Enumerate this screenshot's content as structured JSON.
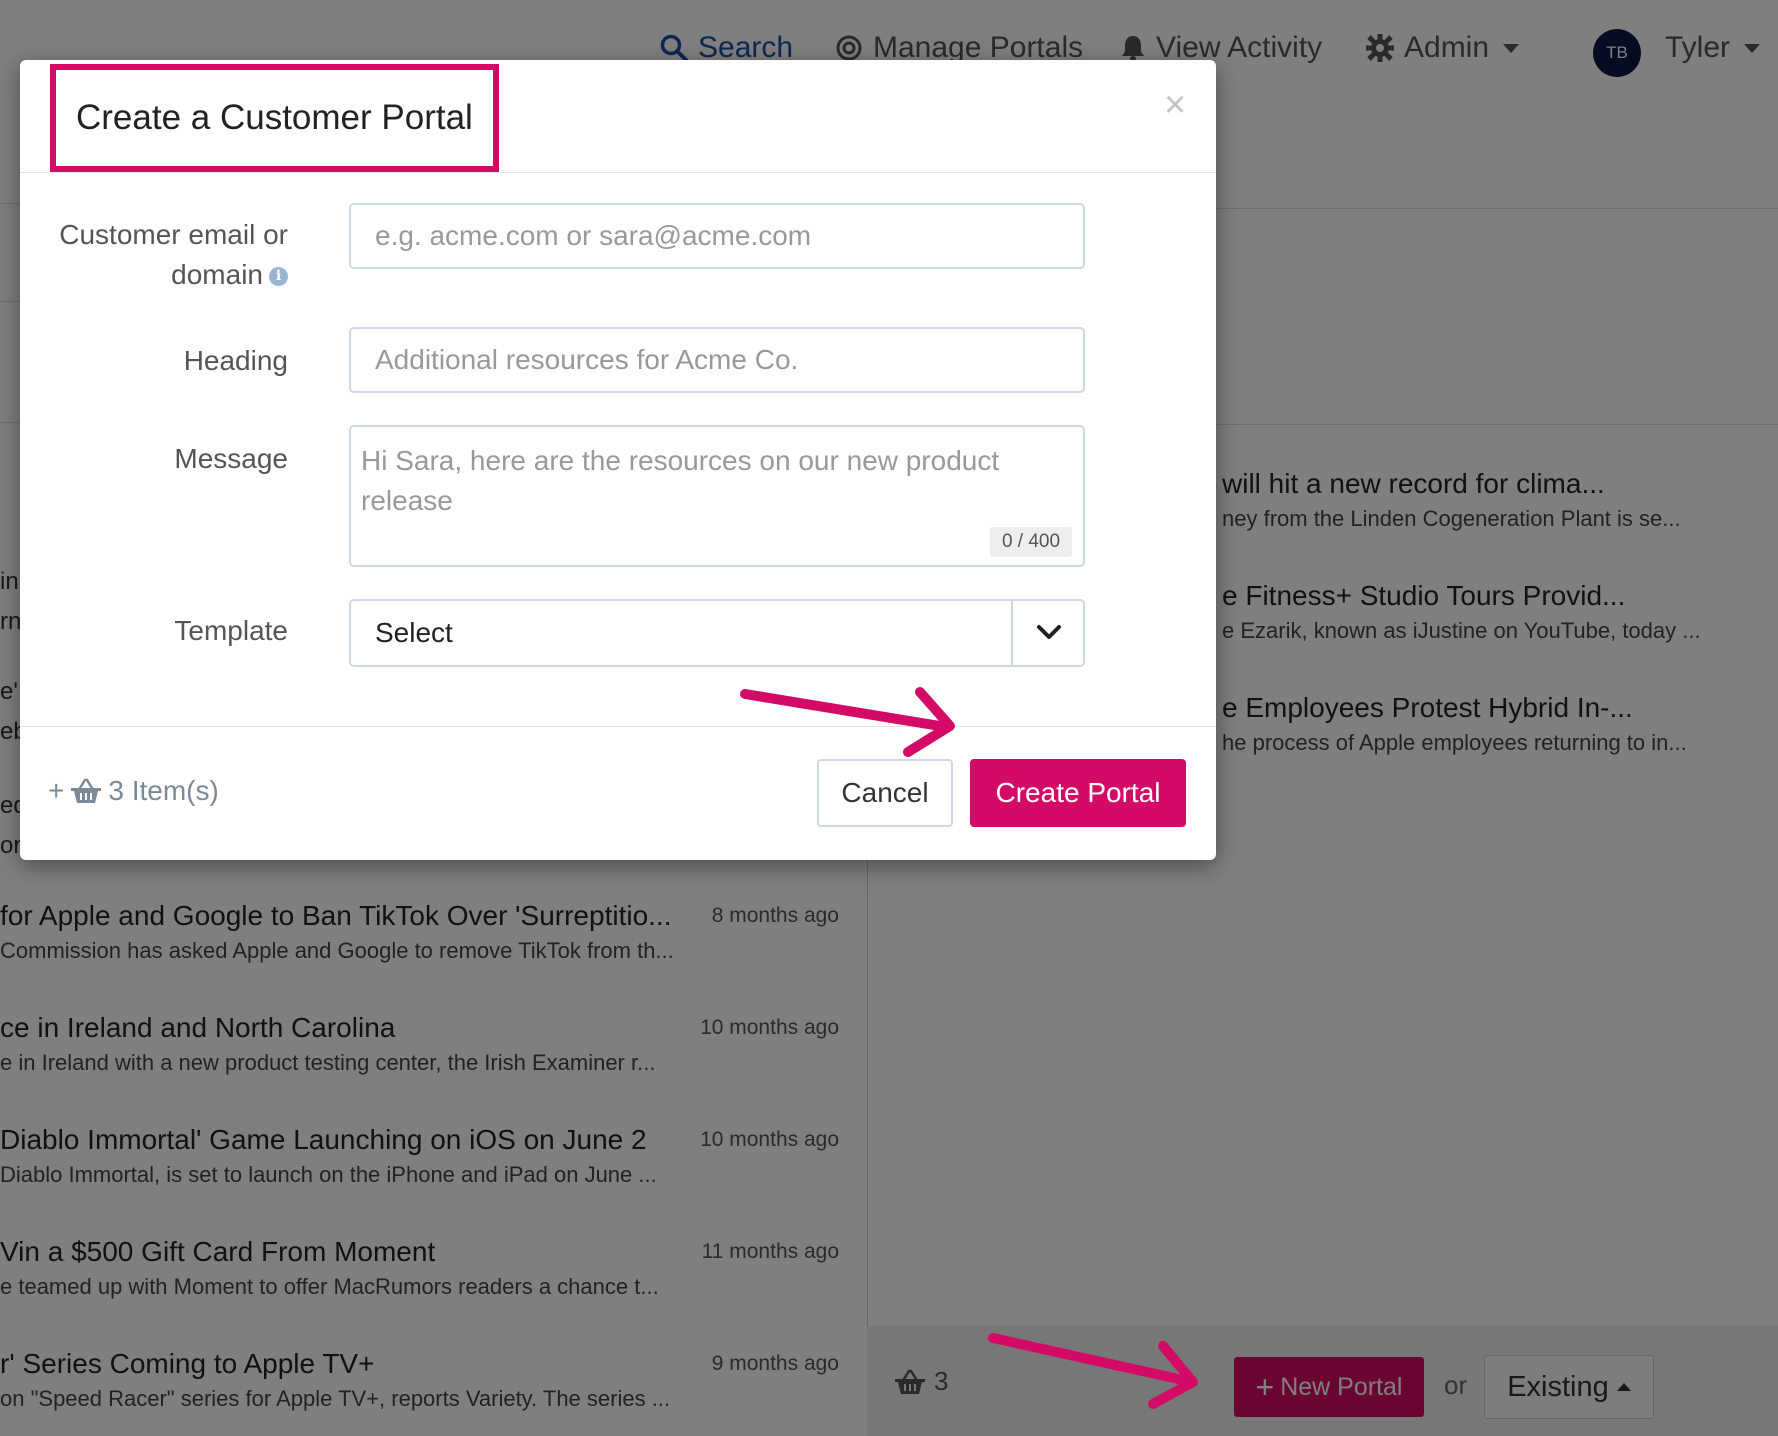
{
  "nav": {
    "search": "Search",
    "manage_portals": "Manage Portals",
    "view_activity": "View Activity",
    "admin": "Admin",
    "avatar_initials": "TB",
    "user_name": "Tyler"
  },
  "left_fragments": [
    "in",
    "rn",
    "e'",
    "eb",
    "ed",
    "on"
  ],
  "news_left": [
    {
      "title": "for Apple and Google to Ban TikTok Over 'Surreptitio...",
      "desc": "Commission has asked Apple and Google to remove TikTok from th...",
      "time": "8 months ago"
    },
    {
      "title": "ce in Ireland and North Carolina",
      "desc": "e in Ireland with a new product testing center, the Irish Examiner r...",
      "time": "10 months ago"
    },
    {
      "title": "Diablo Immortal' Game Launching on iOS on June 2",
      "desc": "Diablo Immortal, is set to launch on the iPhone and iPad on June ...",
      "time": "10 months ago"
    },
    {
      "title": "Vin a $500 Gift Card From Moment",
      "desc": "e teamed up with Moment to offer MacRumors readers a chance t...",
      "time": "11 months ago"
    },
    {
      "title": "r' Series Coming to Apple TV+",
      "desc": "on \"Speed Racer\" series for Apple TV+, reports Variety. The series ...",
      "time": "9 months ago"
    }
  ],
  "news_right": [
    {
      "title": "will hit a new record for clima...",
      "desc": "ney from the Linden Cogeneration Plant is se..."
    },
    {
      "title": "e Fitness+ Studio Tours Provid...",
      "desc": "e Ezarik, known as iJustine on YouTube, today ..."
    },
    {
      "title": "e Employees Protest Hybrid In-...",
      "desc": "he process of Apple employees returning to in..."
    }
  ],
  "bottom_bar": {
    "basket_count": "3",
    "new_portal": "New Portal",
    "or": "or",
    "existing": "Existing"
  },
  "modal": {
    "title": "Create a Customer Portal",
    "close": "×",
    "email_label_line1": "Customer email or",
    "email_label_line2": "domain",
    "email_placeholder": "e.g. acme.com or sara@acme.com",
    "heading_label": "Heading",
    "heading_placeholder": "Additional resources for Acme Co.",
    "message_label": "Message",
    "message_placeholder": "Hi Sara, here are the resources on our new product release",
    "char_counter": "0 / 400",
    "template_label": "Template",
    "template_value": "Select",
    "items_count": "3 Item(s)",
    "cancel": "Cancel",
    "create": "Create Portal"
  },
  "colors": {
    "accent": "#d40b66",
    "nav_active": "#1d4fa8",
    "avatar_bg": "#0c1a45"
  }
}
